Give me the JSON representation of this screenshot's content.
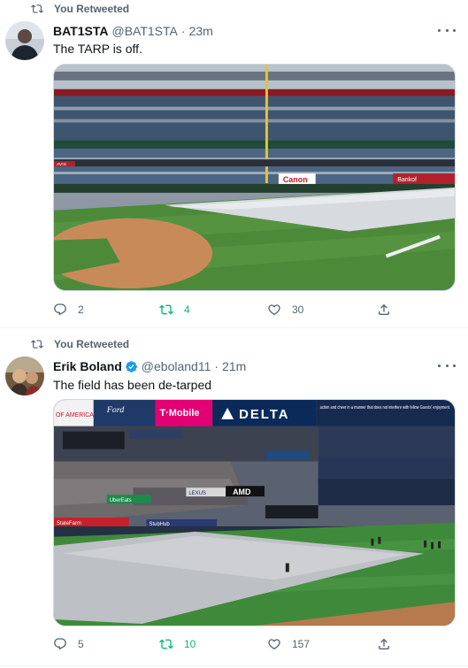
{
  "tweets": [
    {
      "retweet_label": "You Retweeted",
      "name": "BAT1STA",
      "handle": "@BAT1STA",
      "separator": "·",
      "time": "23m",
      "verified": false,
      "text": "The TARP is off.",
      "media_icon": "photo-stadium-tarp-on-field",
      "actions": {
        "replies": "2",
        "retweets": "4",
        "likes": "30"
      },
      "retweet_active_color": "#00ba7c"
    },
    {
      "retweet_label": "You Retweeted",
      "name": "Erik Boland",
      "handle": "@eboland11",
      "separator": "·",
      "time": "21m",
      "verified": true,
      "text": "The field has been de-tarped",
      "media_icon": "photo-stadium-grounds-crew",
      "actions": {
        "replies": "5",
        "retweets": "10",
        "likes": "157"
      },
      "retweet_active_color": "#00ba7c"
    }
  ],
  "photo1_signs": {
    "sponsor_center": "Canon",
    "sponsor_left": "AVIS",
    "sponsor_right": "Bankof"
  },
  "photo2_signs": {
    "banner_left": "OF AMERICA",
    "banner_ford": "Ford",
    "banner_mobile": "T·Mobile",
    "banner_delta": "DELTA",
    "banner_msg": "action and cheer in a manner that does not interfere with fellow Guests' enjoyment.",
    "amd": "AMD",
    "ubereats": "UberEats",
    "statefarm": "StateFarm",
    "stubhub": "StubHub",
    "lexus": "LEXUS"
  }
}
